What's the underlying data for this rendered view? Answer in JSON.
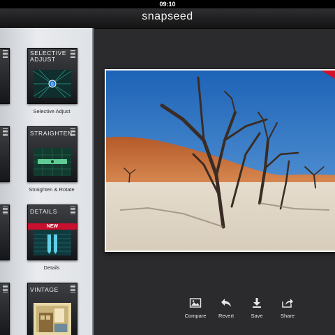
{
  "status_bar": {
    "time": "09:10"
  },
  "app": {
    "title": "snapseed"
  },
  "sidebar": {
    "cards": [
      {
        "title": "SELECTIVE ADJUST",
        "label": "Selective Adjust",
        "icon": "selective-adjust-icon"
      },
      {
        "title": "STRAIGHTEN",
        "label": "Straighten & Rotate",
        "icon": "straighten-icon"
      },
      {
        "title": "DETAILS",
        "label": "Details",
        "badge": "NEW",
        "icon": "details-icon"
      },
      {
        "title": "VINTAGE",
        "label": "",
        "icon": "vintage-icon"
      }
    ]
  },
  "toolbar": {
    "compare": "Compare",
    "revert": "Revert",
    "save": "Save",
    "share": "Share"
  },
  "colors": {
    "accent_red": "#c8102e",
    "card_dark": "#1c1d20",
    "background": "#2b2b2d"
  }
}
